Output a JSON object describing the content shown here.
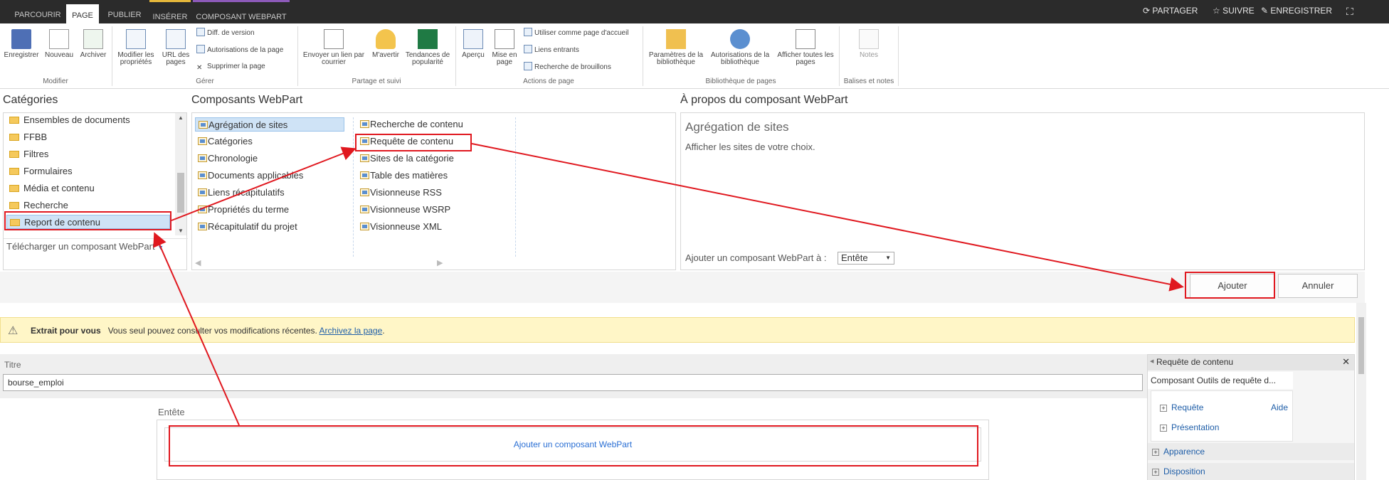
{
  "tabs": [
    "PARCOURIR",
    "PAGE",
    "PUBLIER",
    "INSÉRER",
    "COMPOSANT WEBPART"
  ],
  "top_actions": {
    "share": "PARTAGER",
    "follow": "SUIVRE",
    "save": "ENREGISTRER"
  },
  "ribbon": {
    "modifier": {
      "save": "Enregistrer",
      "new": "Nouveau",
      "archive": "Archiver",
      "group": "Modifier"
    },
    "gerer": {
      "edit_props": "Modifier les propriétés",
      "url": "URL des pages",
      "diff": "Diff. de version",
      "perms": "Autorisations de la page",
      "delete": "Supprimer la page",
      "group": "Gérer"
    },
    "partage": {
      "send": "Envoyer un lien par courrier",
      "alert": "M'avertir",
      "trends": "Tendances de popularité",
      "group": "Partage et suivi"
    },
    "actions": {
      "preview": "Aperçu",
      "layout": "Mise en page",
      "home": "Utiliser comme page d'accueil",
      "links": "Liens entrants",
      "drafts": "Recherche de brouillons",
      "group": "Actions de page"
    },
    "bibliotheque": {
      "params": "Paramètres de la bibliothèque",
      "perms": "Autorisations de la bibliothèque",
      "all": "Afficher toutes les pages",
      "group": "Bibliothèque de pages"
    },
    "notes": {
      "notes": "Notes",
      "group": "Balises et notes"
    }
  },
  "categories": {
    "title": "Catégories",
    "items": [
      "Ensembles de documents",
      "FFBB",
      "Filtres",
      "Formulaires",
      "Média et contenu",
      "Recherche",
      "Report de contenu"
    ],
    "upload": "Télécharger un composant WebPart"
  },
  "webparts": {
    "title": "Composants WebPart",
    "col1": [
      "Agrégation de sites",
      "Catégories",
      "Chronologie",
      "Documents applicables",
      "Liens récapitulatifs",
      "Propriétés du terme",
      "Récapitulatif du projet"
    ],
    "col2": [
      "Recherche de contenu",
      "Requête de contenu",
      "Sites de la catégorie",
      "Table des matières",
      "Visionneuse RSS",
      "Visionneuse WSRP",
      "Visionneuse XML"
    ]
  },
  "about": {
    "title": "À propos du composant WebPart",
    "name": "Agrégation de sites",
    "desc": "Afficher les sites de votre choix.",
    "add_label": "Ajouter un composant WebPart à :",
    "zone": "Entête"
  },
  "buttons": {
    "add": "Ajouter",
    "cancel": "Annuler"
  },
  "notice": {
    "bold": "Extrait pour vous",
    "text": "Vous seul pouvez consulter vos modifications récentes.",
    "link": "Archivez la page",
    "end": "."
  },
  "page": {
    "title_label": "Titre",
    "title_value": "bourse_emploi",
    "zone_label": "Entête",
    "add_webpart": "Ajouter un composant WebPart"
  },
  "toolpane": {
    "title": "Requête de contenu",
    "subtitle": "Composant Outils de requête d...",
    "query": "Requête",
    "help": "Aide",
    "presentation": "Présentation",
    "appearance": "Apparence",
    "layout": "Disposition"
  }
}
